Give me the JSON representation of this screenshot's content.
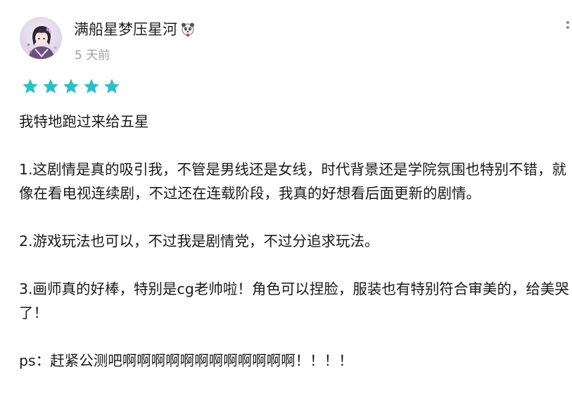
{
  "review": {
    "username": "满船星梦压星河",
    "badge_icon": "panda-icon",
    "timestamp": "5 天前",
    "more_icon": "more-vertical-icon",
    "rating": 5,
    "rating_color": "#2bc0c8",
    "paragraphs": [
      "我特地跑过来给五星",
      "1.这剧情是真的吸引我，不管是男线还是女线，时代背景还是学院氛围也特别不错，就像在看电视连续剧，不过还在连载阶段，我真的好想看后面更新的剧情。",
      "2.游戏玩法也可以，不过我是剧情党，不过分追求玩法。",
      "3.画师真的好棒，特别是cg老帅啦！角色可以捏脸，服装也有特别符合审美的，给美哭了！",
      "ps：赶紧公测吧啊啊啊啊啊啊啊啊啊啊啊啊！！！！"
    ]
  }
}
